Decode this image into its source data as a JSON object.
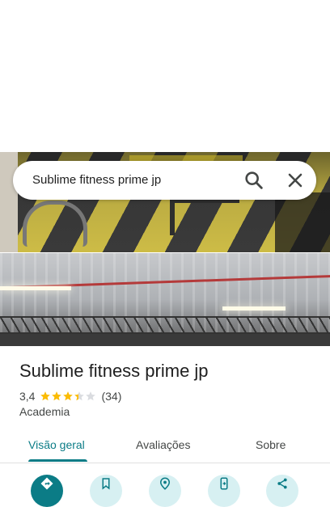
{
  "search": {
    "query": "Sublime fitness prime jp"
  },
  "place": {
    "name": "Sublime fitness prime jp",
    "rating": "3,4",
    "rating_stars": 3.4,
    "review_count": "(34)",
    "category": "Academia"
  },
  "tabs": [
    {
      "label": "Visão geral",
      "active": true
    },
    {
      "label": "Avaliações",
      "active": false
    },
    {
      "label": "Sobre",
      "active": false
    }
  ],
  "actions": [
    {
      "icon": "directions-icon"
    },
    {
      "icon": "bookmark-icon"
    },
    {
      "icon": "nearby-icon"
    },
    {
      "icon": "send-to-phone-icon"
    },
    {
      "icon": "share-icon"
    }
  ],
  "colors": {
    "accent": "#0b7c86",
    "accent_light": "#d7f0f2",
    "star": "#fbbc04",
    "star_empty": "#dadce0"
  }
}
